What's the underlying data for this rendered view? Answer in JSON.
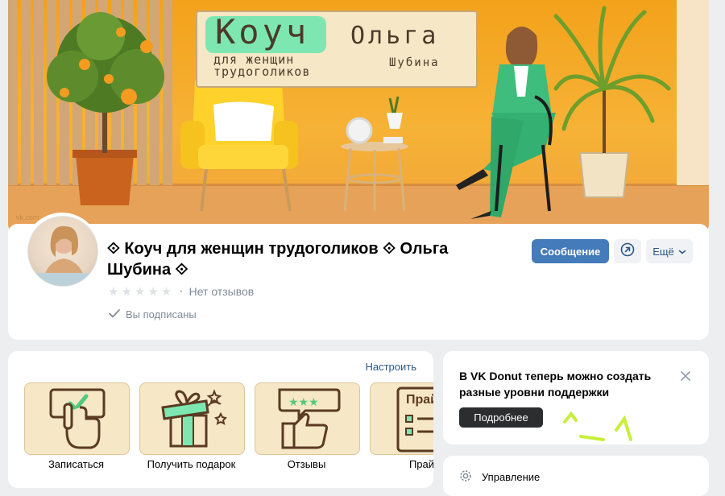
{
  "cover": {
    "title_word": "Коуч",
    "subtitle_line1": "для женщин",
    "subtitle_line2": "трудоголиков",
    "first_name": "Ольга",
    "last_name": "Шубина",
    "watermark": "vk.com"
  },
  "profile": {
    "name": "⟐ Коуч для женщин трудоголиков ⟐ Ольга Шубина ⟐",
    "rating_stars": 0,
    "rating_max": 5,
    "reviews_text": "Нет отзывов",
    "subscribed_text": "Вы подписаны",
    "message_button": "Сообщение",
    "share_icon": "share-arrow-icon",
    "more_button": "Ещё"
  },
  "menu": {
    "setup_link": "Настроить",
    "items": [
      {
        "label": "Записаться",
        "icon": "hand-click-checkbox-icon"
      },
      {
        "label": "Получить подарок",
        "icon": "gift-box-icon"
      },
      {
        "label": "Отзывы",
        "icon": "thumbs-up-stars-icon"
      },
      {
        "label": "Прай",
        "icon": "price-list-icon",
        "tile_text": "Прай"
      }
    ]
  },
  "donut": {
    "text": "В VK Donut теперь можно создать разные уровни поддержки",
    "button": "Подробнее",
    "close_icon": "close-icon"
  },
  "manage": {
    "label": "Управление",
    "icon": "gear-icon"
  },
  "colors": {
    "accent": "#447bba",
    "link": "#2a5885",
    "background": "#edeef0",
    "tile_bg": "#f6e7c6",
    "tile_icon": "#5a3a22",
    "tile_green": "#7ee7b1",
    "donut_button": "#2c2d2e",
    "donut_decor": "#c8ef3c"
  }
}
